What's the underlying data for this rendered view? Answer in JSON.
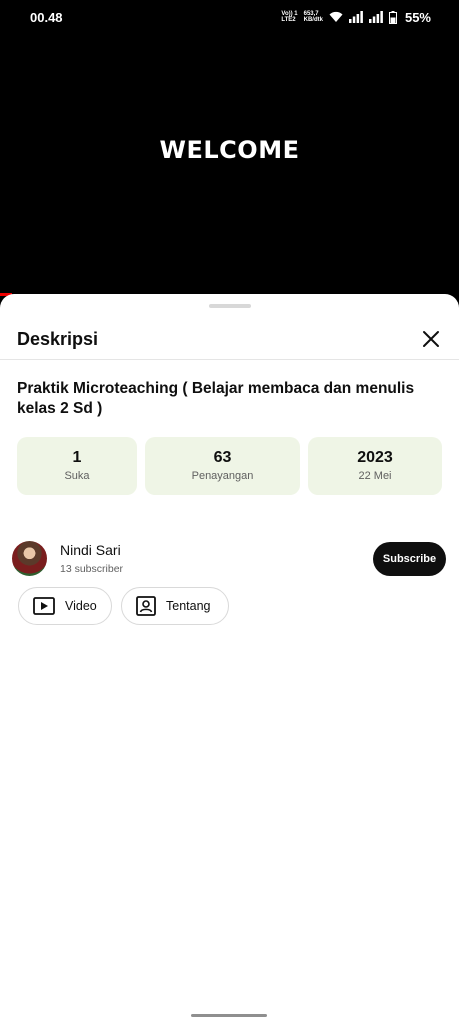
{
  "status_bar": {
    "time": "00.48",
    "net_top": "Vo)) 1",
    "net_bottom": "LTE2",
    "speed_value": "653,7",
    "speed_unit": "KB/dtk",
    "battery": "55%"
  },
  "video": {
    "overlay_text": "WELCOME"
  },
  "sheet": {
    "title": "Deskripsi",
    "video_title": "Praktik Microteaching ( Belajar membaca dan menulis kelas 2 Sd )",
    "stats": [
      {
        "value": "1",
        "label": "Suka"
      },
      {
        "value": "63",
        "label": "Penayangan"
      },
      {
        "value": "2023",
        "label": "22 Mei"
      }
    ],
    "channel": {
      "name": "Nindi Sari",
      "subscribers": "13 subscriber",
      "subscribe_label": "Subscribe"
    },
    "chips": [
      {
        "label": "Video",
        "icon": "video-icon"
      },
      {
        "label": "Tentang",
        "icon": "contact-icon"
      }
    ]
  },
  "colors": {
    "stat_bg": "#eff5e6",
    "accent": "#0f0f0f",
    "progress": "#e00000"
  }
}
